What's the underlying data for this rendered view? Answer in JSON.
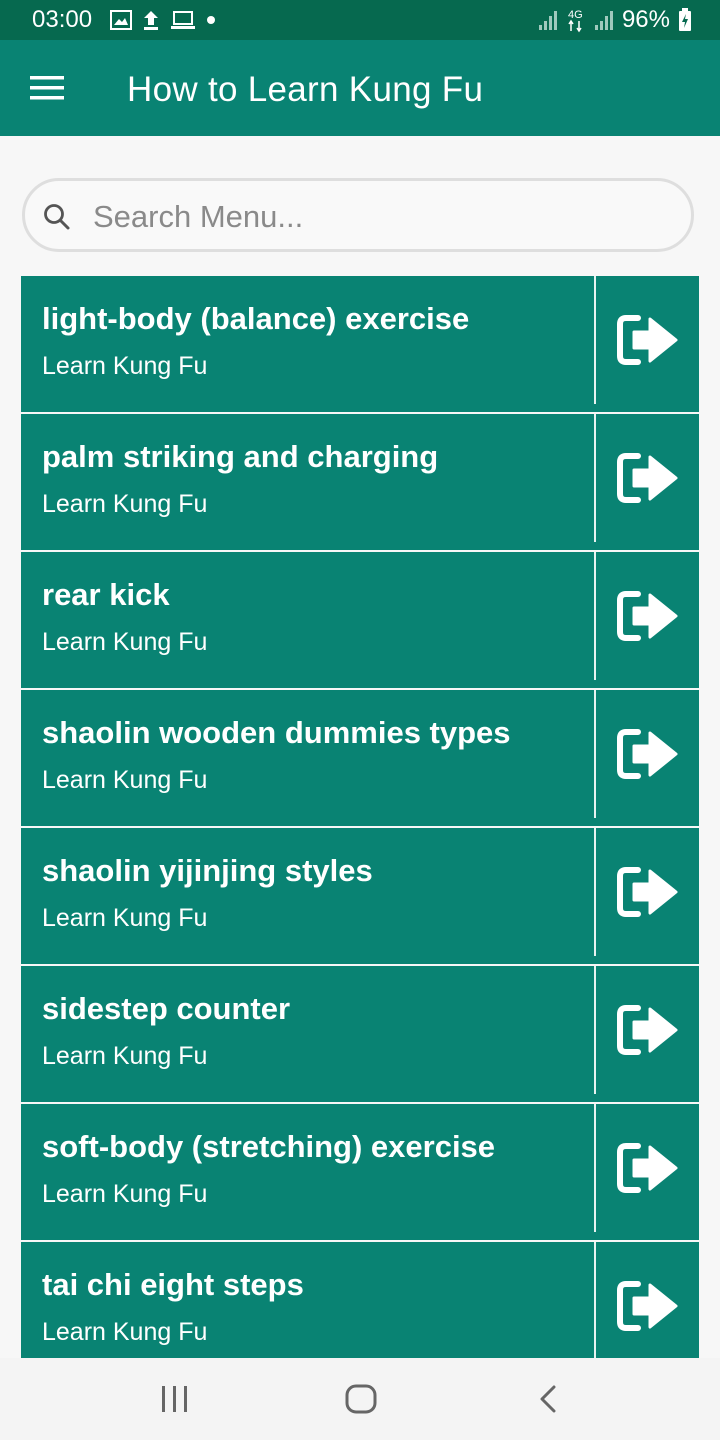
{
  "status_bar": {
    "time": "03:00",
    "network_label": "4G",
    "battery": "96%",
    "icons_left": [
      "image-icon",
      "upload-icon",
      "laptop-icon",
      "dot-icon"
    ],
    "icons_right": [
      "signal-icon",
      "network-4g-icon",
      "signal-icon",
      "battery-charging-icon"
    ]
  },
  "app_bar": {
    "title": "How to Learn Kung Fu",
    "menu_icon": "hamburger-menu-icon"
  },
  "search": {
    "placeholder": "Search Menu...",
    "value": "",
    "icon": "search-icon"
  },
  "list": {
    "items": [
      {
        "title": "light-body (balance) exercise",
        "subtitle": "Learn Kung Fu"
      },
      {
        "title": "palm striking and charging",
        "subtitle": "Learn Kung Fu"
      },
      {
        "title": "rear kick",
        "subtitle": "Learn Kung Fu"
      },
      {
        "title": "shaolin wooden dummies types",
        "subtitle": "Learn Kung Fu"
      },
      {
        "title": "shaolin yijinjing styles",
        "subtitle": "Learn Kung Fu"
      },
      {
        "title": "sidestep counter",
        "subtitle": "Learn Kung Fu"
      },
      {
        "title": "soft-body (stretching) exercise",
        "subtitle": "Learn Kung Fu"
      },
      {
        "title": "tai chi eight steps",
        "subtitle": "Learn Kung Fu"
      }
    ],
    "item_action_icon": "sign-out-arrow-icon"
  },
  "nav_bar": {
    "icons": [
      "recent-apps-icon",
      "home-icon",
      "back-icon"
    ]
  },
  "colors": {
    "status_bar": "#06694f",
    "app_bar": "#098373",
    "list_item": "#098373",
    "background": "#f7f7f7"
  }
}
